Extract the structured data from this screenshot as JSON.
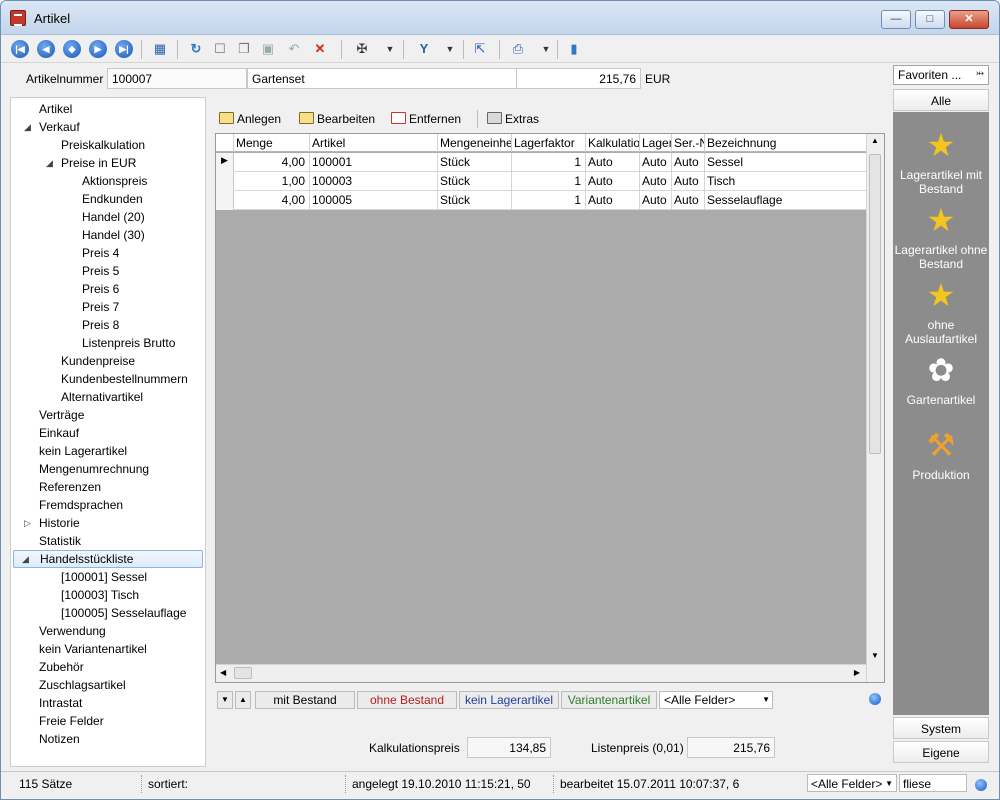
{
  "window": {
    "title": "Artikel"
  },
  "header": {
    "artnr_label": "Artikelnummer",
    "artnr_value": "100007",
    "name_value": "Gartenset",
    "price_value": "215,76",
    "currency": "EUR"
  },
  "tree": [
    {
      "label": "Artikel",
      "level": 0,
      "expander": ""
    },
    {
      "label": "Verkauf",
      "level": 0,
      "expander": "open"
    },
    {
      "label": "Preiskalkulation",
      "level": 1,
      "expander": ""
    },
    {
      "label": "Preise in EUR",
      "level": 1,
      "expander": "open"
    },
    {
      "label": "Aktionspreis",
      "level": 2,
      "expander": ""
    },
    {
      "label": "Endkunden",
      "level": 2,
      "expander": ""
    },
    {
      "label": "Handel (20)",
      "level": 2,
      "expander": ""
    },
    {
      "label": "Handel (30)",
      "level": 2,
      "expander": ""
    },
    {
      "label": "Preis 4",
      "level": 2,
      "expander": ""
    },
    {
      "label": "Preis 5",
      "level": 2,
      "expander": ""
    },
    {
      "label": "Preis 6",
      "level": 2,
      "expander": ""
    },
    {
      "label": "Preis 7",
      "level": 2,
      "expander": ""
    },
    {
      "label": "Preis 8",
      "level": 2,
      "expander": ""
    },
    {
      "label": "Listenpreis Brutto",
      "level": 2,
      "expander": ""
    },
    {
      "label": "Kundenpreise",
      "level": 1,
      "expander": ""
    },
    {
      "label": "Kundenbestellnummern",
      "level": 1,
      "expander": ""
    },
    {
      "label": "Alternativartikel",
      "level": 1,
      "expander": ""
    },
    {
      "label": "Verträge",
      "level": 0,
      "expander": ""
    },
    {
      "label": "Einkauf",
      "level": 0,
      "expander": ""
    },
    {
      "label": "kein Lagerartikel",
      "level": 0,
      "expander": ""
    },
    {
      "label": "Mengenumrechnung",
      "level": 0,
      "expander": ""
    },
    {
      "label": "Referenzen",
      "level": 0,
      "expander": ""
    },
    {
      "label": "Fremdsprachen",
      "level": 0,
      "expander": ""
    },
    {
      "label": "Historie",
      "level": 0,
      "expander": "closed"
    },
    {
      "label": "Statistik",
      "level": 0,
      "expander": ""
    },
    {
      "label": "Handelsstückliste",
      "level": 0,
      "expander": "open",
      "selected": true
    },
    {
      "label": "[100001]  Sessel",
      "level": 1,
      "expander": ""
    },
    {
      "label": "[100003]  Tisch",
      "level": 1,
      "expander": ""
    },
    {
      "label": "[100005]  Sesselauflage",
      "level": 1,
      "expander": ""
    },
    {
      "label": "Verwendung",
      "level": 0,
      "expander": ""
    },
    {
      "label": "kein Variantenartikel",
      "level": 0,
      "expander": ""
    },
    {
      "label": "Zubehör",
      "level": 0,
      "expander": ""
    },
    {
      "label": "Zuschlagsartikel",
      "level": 0,
      "expander": ""
    },
    {
      "label": "Intrastat",
      "level": 0,
      "expander": ""
    },
    {
      "label": "Freie Felder",
      "level": 0,
      "expander": ""
    },
    {
      "label": "Notizen",
      "level": 0,
      "expander": ""
    }
  ],
  "subtoolbar": {
    "new": "Anlegen",
    "edit": "Bearbeiten",
    "remove": "Entfernen",
    "extras": "Extras"
  },
  "grid": {
    "columns": [
      "Menge",
      "Artikel",
      "Mengeneinheit",
      "Lagerfaktor",
      "Kalkulation",
      "Lager",
      "Ser.-Nr",
      "Bezeichnung"
    ],
    "rows": [
      [
        "4,00",
        "100001",
        "Stück",
        "1",
        "Auto",
        "Auto",
        "Auto",
        "Sessel"
      ],
      [
        "1,00",
        "100003",
        "Stück",
        "1",
        "Auto",
        "Auto",
        "Auto",
        "Tisch"
      ],
      [
        "4,00",
        "100005",
        "Stück",
        "1",
        "Auto",
        "Auto",
        "Auto",
        "Sesselauflage"
      ]
    ]
  },
  "filters": {
    "with_stock": "mit Bestand",
    "without_stock": "ohne Bestand",
    "no_stock_item": "kein Lagerartikel",
    "variant_item": "Variantenartikel",
    "all_fields": "<Alle Felder>",
    "colors": {
      "without_stock": "#b02020",
      "no_stock_item": "#1f3f9e",
      "variant_item": "#2e7d2e"
    }
  },
  "totals": {
    "calc_label": "Kalkulationspreis",
    "calc_value": "134,85",
    "list_label": "Listenpreis (0,01)",
    "list_value": "215,76"
  },
  "favorites": {
    "header": "Favoriten ...",
    "tab_all": "Alle",
    "items": [
      {
        "label": "Lagerartikel mit Bestand",
        "icon": "star-icon"
      },
      {
        "label": "Lagerartikel ohne Bestand",
        "icon": "star-icon"
      },
      {
        "label": "ohne Auslaufartikel",
        "icon": "star-icon"
      },
      {
        "label": "Gartenartikel",
        "icon": "flower-icon"
      },
      {
        "label": "Produktion",
        "icon": "wrench-icon"
      }
    ],
    "tab_system": "System",
    "tab_own": "Eigene"
  },
  "status": {
    "count": "115 Sätze",
    "sorted": "sortiert:",
    "created": "angelegt 19.10.2010 11:15:21, 50",
    "edited": "bearbeitet 15.07.2011 10:07:37,  6",
    "field_select": "<Alle Felder>",
    "search": "fliese"
  }
}
